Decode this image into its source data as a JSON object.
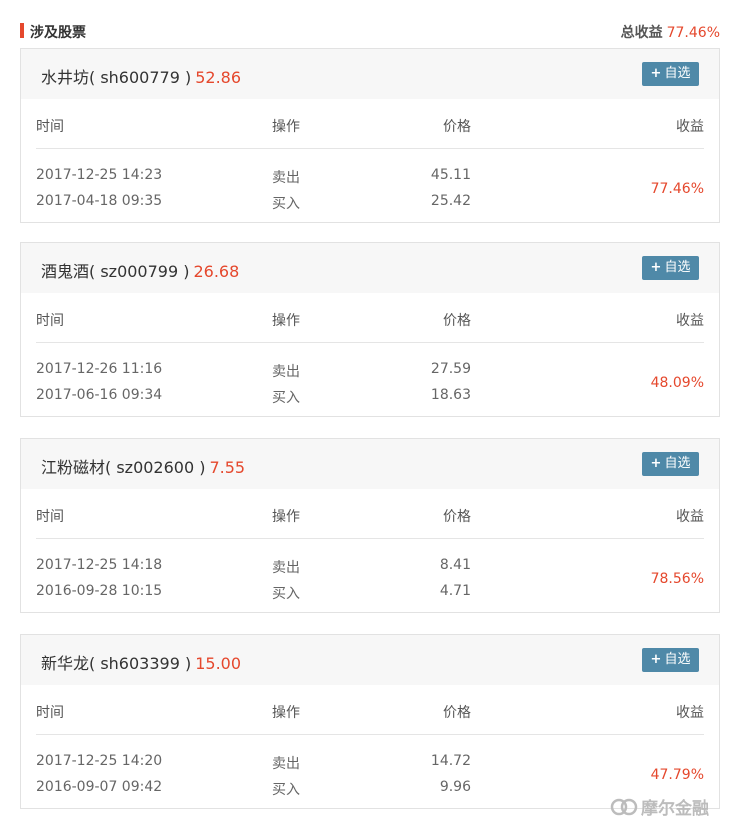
{
  "header": {
    "title": "涉及股票",
    "total_label": "总收益",
    "total_value": "77.46%"
  },
  "columns": {
    "time": "时间",
    "op": "操作",
    "price": "价格",
    "return": "收益"
  },
  "add_label": "自选",
  "stocks": [
    {
      "name": "水井坊( sh600779 )",
      "price": "52.86",
      "rows": [
        {
          "time": "2017-12-25 14:23",
          "op": "卖出",
          "price": "45.11"
        },
        {
          "time": "2017-04-18 09:35",
          "op": "买入",
          "price": "25.42"
        }
      ],
      "return": "77.46%"
    },
    {
      "name": "酒鬼酒( sz000799 )",
      "price": "26.68",
      "rows": [
        {
          "time": "2017-12-26 11:16",
          "op": "卖出",
          "price": "27.59"
        },
        {
          "time": "2017-06-16 09:34",
          "op": "买入",
          "price": "18.63"
        }
      ],
      "return": "48.09%"
    },
    {
      "name": "江粉磁材( sz002600 )",
      "price": "7.55",
      "rows": [
        {
          "time": "2017-12-25 14:18",
          "op": "卖出",
          "price": "8.41"
        },
        {
          "time": "2016-09-28 10:15",
          "op": "买入",
          "price": "4.71"
        }
      ],
      "return": "78.56%"
    },
    {
      "name": "新华龙( sh603399 )",
      "price": "15.00",
      "rows": [
        {
          "time": "2017-12-25 14:20",
          "op": "卖出",
          "price": "14.72"
        },
        {
          "time": "2016-09-07 09:42",
          "op": "买入",
          "price": "9.96"
        }
      ],
      "return": "47.79%"
    }
  ],
  "watermark": "摩尔金融",
  "colors": {
    "accent_red": "#e5482d",
    "button_blue": "#4f89a8"
  }
}
